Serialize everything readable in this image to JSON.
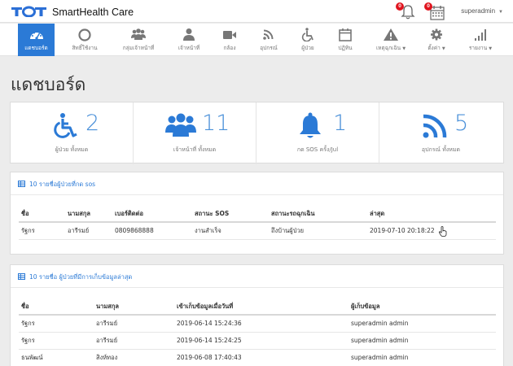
{
  "header": {
    "brand": "SmartHealth Care",
    "notifications_count": "0",
    "calendar_count": "0",
    "user": "superadmin"
  },
  "nav": [
    {
      "label": "แดชบอร์ด",
      "icon": "dashboard-icon",
      "active": true
    },
    {
      "label": "สิทธิ์ใช้งาน",
      "icon": "circle-icon"
    },
    {
      "label": "กลุ่มเจ้าหน้าที่",
      "icon": "users-icon"
    },
    {
      "label": "เจ้าหน้าที่",
      "icon": "user-icon"
    },
    {
      "label": "กล้อง",
      "icon": "video-camera-icon"
    },
    {
      "label": "อุปกรณ์",
      "icon": "rss-icon"
    },
    {
      "label": "ผู้ป่วย",
      "icon": "wheelchair-icon"
    },
    {
      "label": "ปฏิทิน",
      "icon": "calendar-icon"
    },
    {
      "label": "เหตุฉุกเฉิน",
      "icon": "warning-icon",
      "dropdown": true
    },
    {
      "label": "ตั้งค่า",
      "icon": "gear-icon",
      "dropdown": true
    },
    {
      "label": "รายงาน",
      "icon": "signal-bars-icon",
      "dropdown": true
    }
  ],
  "page_title": "แดชบอร์ด",
  "stats": [
    {
      "value": "2",
      "label": "ผู้ป่วย ทั้งหมด",
      "icon": "wheelchair-icon"
    },
    {
      "value": "11",
      "label": "เจ้าหน้าที่ ทั้งหมด",
      "icon": "users-icon"
    },
    {
      "value": "1",
      "label": "กด SOS ครั้ง/Jul",
      "icon": "bell-icon"
    },
    {
      "value": "5",
      "label": "อุปกรณ์ ทั้งหมด",
      "icon": "rss-icon"
    }
  ],
  "sos_panel": {
    "title": "10 รายชื่อผู้ป่วยที่กด sos",
    "columns": [
      "ชื่อ",
      "นามสกุล",
      "เบอร์ติดต่อ",
      "สถานะ SOS",
      "สถานะรถฉุกเฉิน",
      "ล่าสุด"
    ],
    "rows": [
      [
        "รัฐกร",
        "อารีรมย์",
        "0809868888",
        "งานสำเร็จ",
        "ถึงบ้านผู้ป่วย",
        "2019-07-10 20:18:22"
      ]
    ]
  },
  "records_panel": {
    "title": "10 รายชื่อ ผู้ป่วยที่มีการเก็บข้อมูลล่าสุด",
    "columns": [
      "ชื่อ",
      "นามสกุล",
      "เข้าเก็บข้อมูลเมื่อวันที่",
      "ผู้เก็บข้อมูล"
    ],
    "rows": [
      [
        "รัฐกร",
        "อารีรมย์",
        "2019-06-14 15:24:36",
        "superadmin admin"
      ],
      [
        "รัฐกร",
        "อารีรมย์",
        "2019-06-14 15:24:25",
        "superadmin admin"
      ],
      [
        "ธนพัฒน์",
        "สิงห์ทอง",
        "2019-06-08 17:40:43",
        "superadmin admin"
      ]
    ]
  },
  "colors": {
    "accent": "#2b7ad6",
    "stat_number": "#4a90d9",
    "badge": "#e0141e"
  }
}
